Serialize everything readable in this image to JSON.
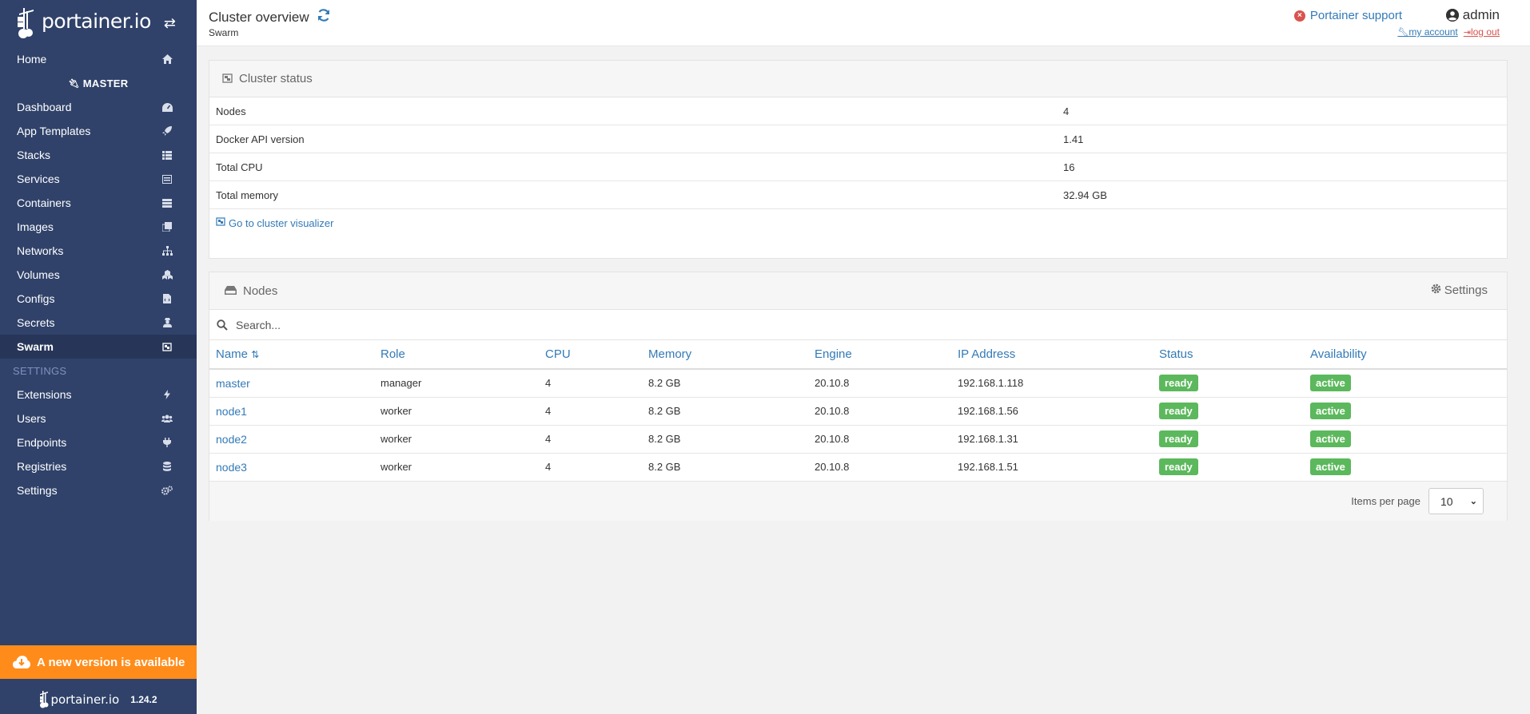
{
  "brand": {
    "logo_text": "portainer.io"
  },
  "sidebar": {
    "home": "Home",
    "endpoint_label": "MASTER",
    "items": [
      {
        "label": "Dashboard",
        "icon": "tachometer-icon"
      },
      {
        "label": "App Templates",
        "icon": "rocket-icon"
      },
      {
        "label": "Stacks",
        "icon": "th-list-icon"
      },
      {
        "label": "Services",
        "icon": "list-alt-icon"
      },
      {
        "label": "Containers",
        "icon": "server-icon"
      },
      {
        "label": "Images",
        "icon": "clone-icon"
      },
      {
        "label": "Networks",
        "icon": "sitemap-icon"
      },
      {
        "label": "Volumes",
        "icon": "cubes-icon"
      },
      {
        "label": "Configs",
        "icon": "file-code-icon"
      },
      {
        "label": "Secrets",
        "icon": "user-secret-icon"
      },
      {
        "label": "Swarm",
        "icon": "object-group-icon"
      }
    ],
    "settings_header": "SETTINGS",
    "settings_items": [
      {
        "label": "Extensions",
        "icon": "bolt-icon"
      },
      {
        "label": "Users",
        "icon": "users-icon"
      },
      {
        "label": "Endpoints",
        "icon": "plug-icon"
      },
      {
        "label": "Registries",
        "icon": "database-icon"
      },
      {
        "label": "Settings",
        "icon": "cogs-icon"
      }
    ],
    "update_notice": "A new version is available",
    "footer_logo": "portainer.io",
    "version": "1.24.2"
  },
  "header": {
    "title": "Cluster overview",
    "subtitle": "Swarm",
    "support": "Portainer support",
    "user": "admin",
    "my_account": "my account",
    "log_out": "log out"
  },
  "cluster_status": {
    "title": "Cluster status",
    "rows": [
      {
        "key": "Nodes",
        "value": "4"
      },
      {
        "key": "Docker API version",
        "value": "1.41"
      },
      {
        "key": "Total CPU",
        "value": "16"
      },
      {
        "key": "Total memory",
        "value": "32.94 GB"
      }
    ],
    "visualizer_link": "Go to cluster visualizer"
  },
  "nodes": {
    "title": "Nodes",
    "settings": "Settings",
    "search_placeholder": "Search...",
    "columns": [
      "Name",
      "Role",
      "CPU",
      "Memory",
      "Engine",
      "IP Address",
      "Status",
      "Availability"
    ],
    "rows": [
      {
        "name": "master",
        "role": "manager",
        "cpu": "4",
        "memory": "8.2 GB",
        "engine": "20.10.8",
        "ip": "192.168.1.118",
        "status": "ready",
        "availability": "active"
      },
      {
        "name": "node1",
        "role": "worker",
        "cpu": "4",
        "memory": "8.2 GB",
        "engine": "20.10.8",
        "ip": "192.168.1.56",
        "status": "ready",
        "availability": "active"
      },
      {
        "name": "node2",
        "role": "worker",
        "cpu": "4",
        "memory": "8.2 GB",
        "engine": "20.10.8",
        "ip": "192.168.1.31",
        "status": "ready",
        "availability": "active"
      },
      {
        "name": "node3",
        "role": "worker",
        "cpu": "4",
        "memory": "8.2 GB",
        "engine": "20.10.8",
        "ip": "192.168.1.51",
        "status": "ready",
        "availability": "active"
      }
    ],
    "items_per_page_label": "Items per page",
    "items_per_page_value": "10"
  },
  "colors": {
    "sidebar": "#30426a",
    "accent": "#337ab7",
    "success": "#5cb85c",
    "warning": "#ff8c1a",
    "danger": "#d9534f"
  }
}
